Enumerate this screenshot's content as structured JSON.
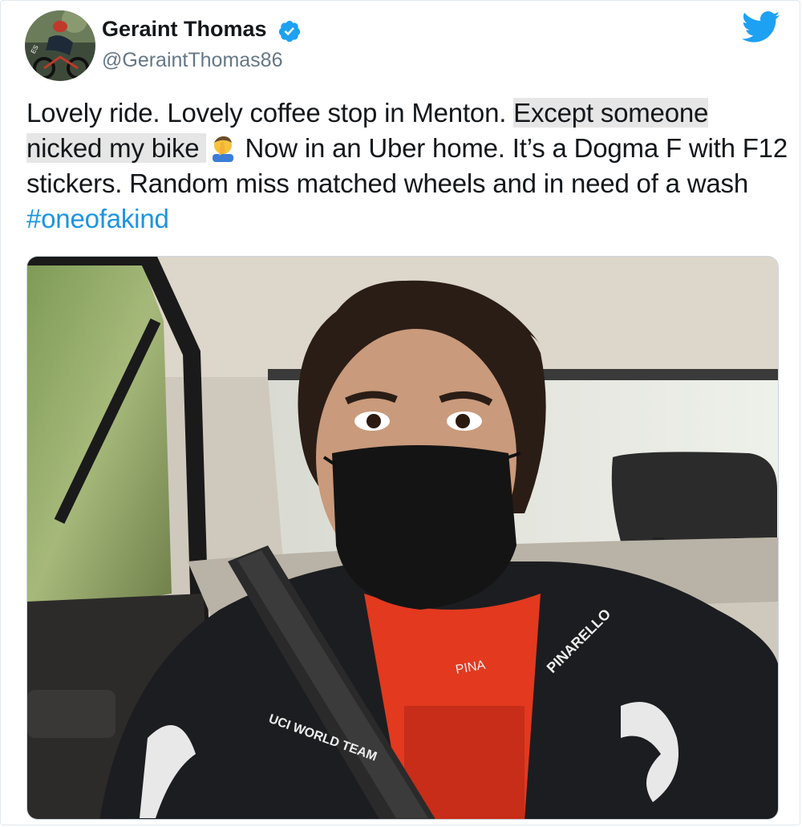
{
  "author": {
    "name": "Geraint Thomas",
    "handle": "@GeraintThomas86",
    "verified": true,
    "avatar_icon": "cyclist-avatar"
  },
  "tweet": {
    "text_part1": "Lovely ride. Lovely coffee stop in Menton. ",
    "text_highlight_1": "Except someone",
    "text_highlight_2": "nicked my bike ",
    "emoji": "face-palm-emoji",
    "text_part2": "Now in an Uber home. It’s a Dogma F with F12 stickers. Random miss matched wheels and in need of a wash ",
    "hashtag": "#oneofakind"
  },
  "photo": {
    "jersey_texts": [
      "PINA",
      "PINARELLO",
      "UCI WORLD TEAM"
    ]
  },
  "colors": {
    "twitter_blue": "#1da1f2",
    "link_blue": "#1b95e0",
    "text": "#14171a",
    "secondary": "#657786",
    "highlight": "#e6e6e6"
  },
  "icons": [
    "twitter-bird-icon",
    "verified-badge-icon"
  ]
}
